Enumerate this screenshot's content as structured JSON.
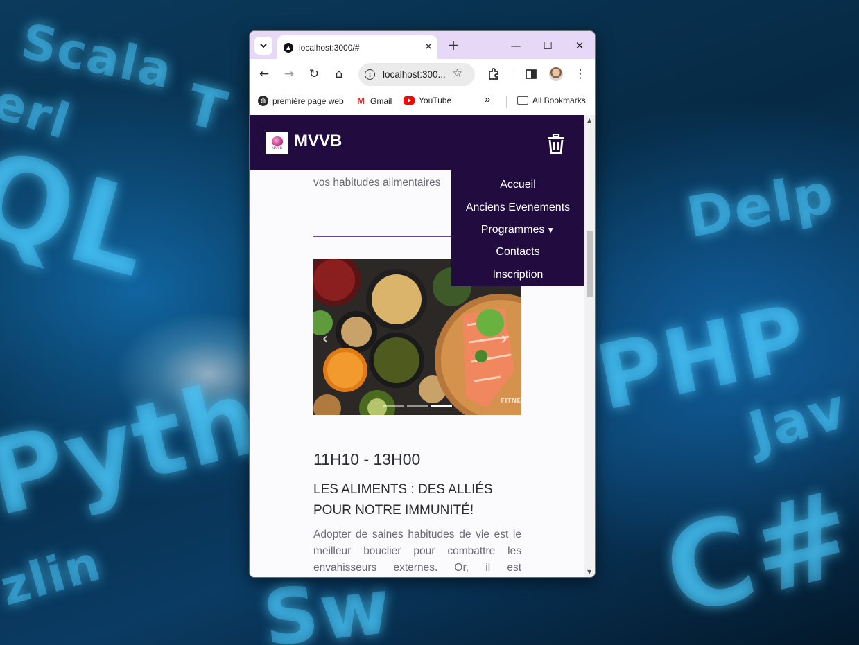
{
  "desktop": {
    "wallpaper_words": [
      "Scala",
      "erl",
      "T",
      "QL",
      "Pyth",
      "zlin",
      "Delp",
      "PHP",
      "Jav",
      "C#",
      "Sw"
    ]
  },
  "browser": {
    "tab": {
      "title": "localhost:3000/#",
      "close_glyph": "✕"
    },
    "new_tab_glyph": "+",
    "window_controls": {
      "minimize": "—",
      "maximize": "☐",
      "close": "✕"
    },
    "toolbar": {
      "back_glyph": "←",
      "forward_glyph": "→",
      "reload_glyph": "↻",
      "home_glyph": "⌂",
      "url": "localhost:300...",
      "star_glyph": "☆",
      "menu_glyph": "⋮"
    },
    "bookmarks": {
      "items": [
        {
          "label": "première page web",
          "icon": "globe-icon"
        },
        {
          "label": "Gmail",
          "icon": "gmail-icon"
        },
        {
          "label": "YouTube",
          "icon": "youtube-icon"
        }
      ],
      "overflow_glyph": "»",
      "all_bookmarks": "All Bookmarks"
    }
  },
  "site": {
    "brand": "MVVB",
    "logo_text": "MVVB",
    "nav": {
      "items": [
        "Accueil",
        "Anciens Evenements",
        "Programmes",
        "Contacts",
        "Inscription"
      ],
      "programmes_caret": "▼"
    },
    "intro_text": "vos habitudes alimentaires",
    "carousel": {
      "prev_glyph": "‹",
      "next_glyph": "›",
      "watermark": "FITNESS",
      "slide_count": 3,
      "active_slide": 3
    },
    "event": {
      "time": "11H10 - 13H00",
      "title": "LES ALIMENTS : DES ALLIÉS POUR NOTRE IMMUNITÉ!",
      "description": "Adopter de saines habitudes de vie est le meilleur bouclier pour combattre les envahisseurs externes. Or, il est"
    }
  },
  "colors": {
    "header_bg": "#210b3f",
    "divider": "#6a48a8",
    "tabstrip": "#e8d8f8",
    "page_bg": "#fbfafd"
  }
}
